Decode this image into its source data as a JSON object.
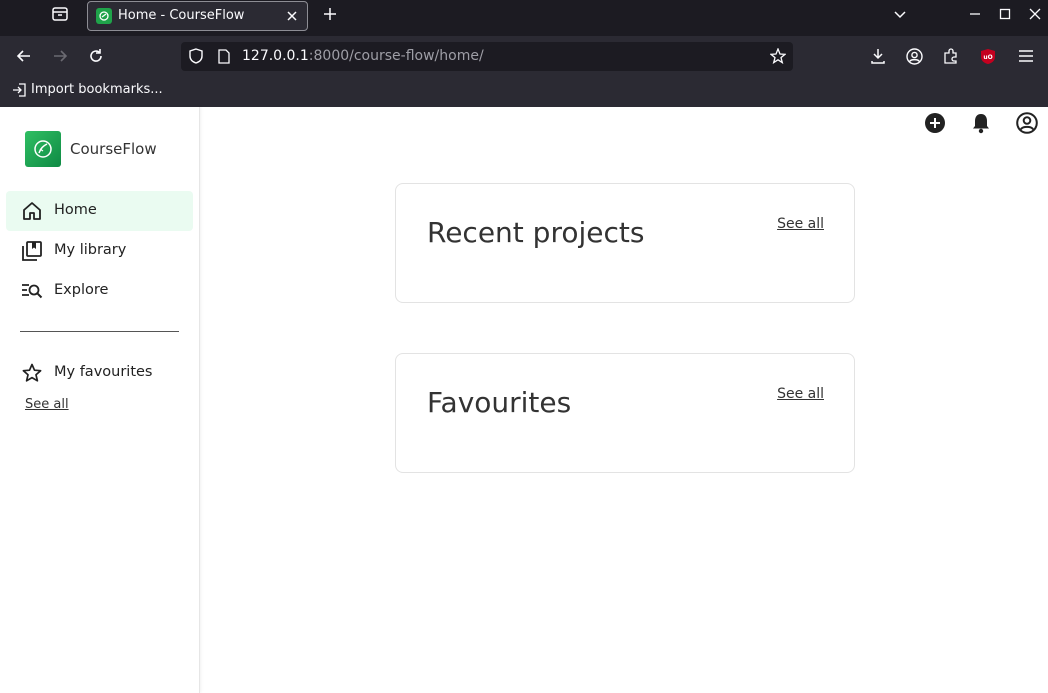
{
  "browser": {
    "tab": {
      "title": "Home - CourseFlow"
    },
    "url": {
      "host": "127.0.0.1",
      "path": ":8000/course-flow/home/"
    },
    "bookmarks": {
      "import_label": "Import bookmarks..."
    },
    "colors": {
      "chrome_dark": "#1c1b22",
      "chrome": "#2b2a33",
      "ublock_red": "#c4001f"
    }
  },
  "app": {
    "name": "CourseFlow",
    "brand_color": "#1fa34a"
  },
  "sidebar": {
    "items": [
      {
        "label": "Home",
        "icon": "home-icon",
        "active": true
      },
      {
        "label": "My library",
        "icon": "library-icon",
        "active": false
      },
      {
        "label": "Explore",
        "icon": "explore-icon",
        "active": false
      }
    ],
    "favourites": {
      "label": "My favourites",
      "icon": "star-icon",
      "see_all": "See all"
    }
  },
  "header_icons": [
    "add-circle-icon",
    "bell-icon",
    "account-icon"
  ],
  "main": {
    "cards": [
      {
        "title": "Recent projects",
        "link": "See all"
      },
      {
        "title": "Favourites",
        "link": "See all"
      }
    ]
  }
}
